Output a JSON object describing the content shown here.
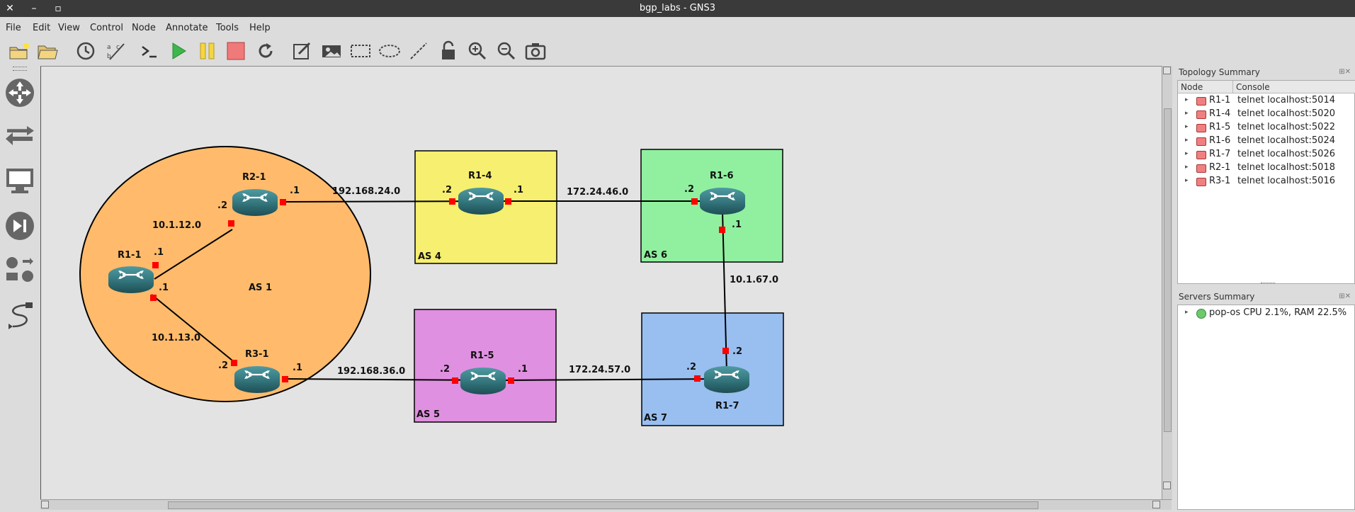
{
  "window": {
    "title": "bgp_labs - GNS3"
  },
  "menu": [
    "File",
    "Edit",
    "View",
    "Control",
    "Node",
    "Annotate",
    "Tools",
    "Help"
  ],
  "toolbar_icons": [
    "new-project-icon",
    "open-project-icon",
    "snapshot-icon",
    "show-interface-labels-icon",
    "console-all-icon",
    "start-all-icon",
    "suspend-all-icon",
    "stop-all-icon",
    "reload-all-icon",
    "add-note-icon",
    "insert-picture-icon",
    "draw-rectangle-icon",
    "draw-ellipse-icon",
    "draw-line-icon",
    "lock-items-icon",
    "zoom-in-icon",
    "zoom-out-icon",
    "screenshot-icon"
  ],
  "left_icons": [
    "browse-routers-icon",
    "browse-switches-icon",
    "browse-end-devices-icon",
    "browse-security-devices-icon",
    "browse-all-devices-icon",
    "add-link-icon"
  ],
  "topology": {
    "areas": {
      "as1": "AS 1",
      "as4": "AS 4",
      "as5": "AS 5",
      "as6": "AS 6",
      "as7": "AS 7"
    },
    "nodes": {
      "r1_1": "R1-1",
      "r2_1": "R2-1",
      "r3_1": "R3-1",
      "r1_4": "R1-4",
      "r1_5": "R1-5",
      "r1_6": "R1-6",
      "r1_7": "R1-7"
    },
    "networks": {
      "n1": "10.1.12.0",
      "n2": "10.1.13.0",
      "n3": "192.168.24.0",
      "n4": "192.168.36.0",
      "n5": "172.24.46.0",
      "n6": "172.24.57.0",
      "n7": "10.1.67.0"
    },
    "iface": {
      "one": ".1",
      "two": ".2"
    }
  },
  "colors": {
    "as1": "#ffbb6b",
    "as4": "#f7ef6f",
    "as5": "#e090e0",
    "as6": "#90f0a0",
    "as7": "#98bff0",
    "port": "#ff0000"
  },
  "topology_summary": {
    "title": "Topology Summary",
    "col_node": "Node",
    "col_console": "Console",
    "rows": [
      {
        "node": "R1-1",
        "console": "telnet localhost:5014"
      },
      {
        "node": "R1-4",
        "console": "telnet localhost:5020"
      },
      {
        "node": "R1-5",
        "console": "telnet localhost:5022"
      },
      {
        "node": "R1-6",
        "console": "telnet localhost:5024"
      },
      {
        "node": "R1-7",
        "console": "telnet localhost:5026"
      },
      {
        "node": "R2-1",
        "console": "telnet localhost:5018"
      },
      {
        "node": "R3-1",
        "console": "telnet localhost:5016"
      }
    ]
  },
  "servers_summary": {
    "title": "Servers Summary",
    "server": "pop-os CPU 2.1%, RAM 22.5%"
  }
}
